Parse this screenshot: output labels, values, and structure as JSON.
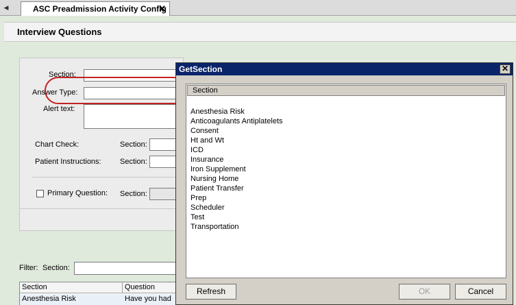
{
  "tab": {
    "label": "ASC Preadmission Activity Config",
    "close_glyph": "✕",
    "scroll_glyph": "◀"
  },
  "page": {
    "title": "Interview Questions"
  },
  "form": {
    "section_label": "Section:",
    "answer_type_label": "Answer Type:",
    "alert_text_label": "Alert text:",
    "chart_check_label": "Chart Check:",
    "chart_check_section_label": "Section:",
    "patient_instructions_label": "Patient Instructions:",
    "patient_instructions_section_label": "Section:",
    "primary_question_label": "Primary Question:",
    "primary_question_section_label": "Section:"
  },
  "filter": {
    "label": "Filter:",
    "section_label": "Section:"
  },
  "grid": {
    "columns": [
      "Section",
      "Question"
    ],
    "rows": [
      [
        "Anesthesia Risk",
        "Have you had"
      ]
    ]
  },
  "dialog": {
    "title": "GetSection",
    "close_glyph": "✕",
    "column_header": "Section",
    "items": [
      "Anesthesia Risk",
      "Anticoagulants Antiplatelets",
      "Consent",
      "Ht and Wt",
      "ICD",
      "Insurance",
      "Iron Supplement",
      "Nursing Home",
      "Patient Transfer",
      "Prep",
      "Scheduler",
      "Test",
      "Transportation"
    ],
    "refresh_label": "Refresh",
    "ok_label": "OK",
    "cancel_label": "Cancel"
  }
}
